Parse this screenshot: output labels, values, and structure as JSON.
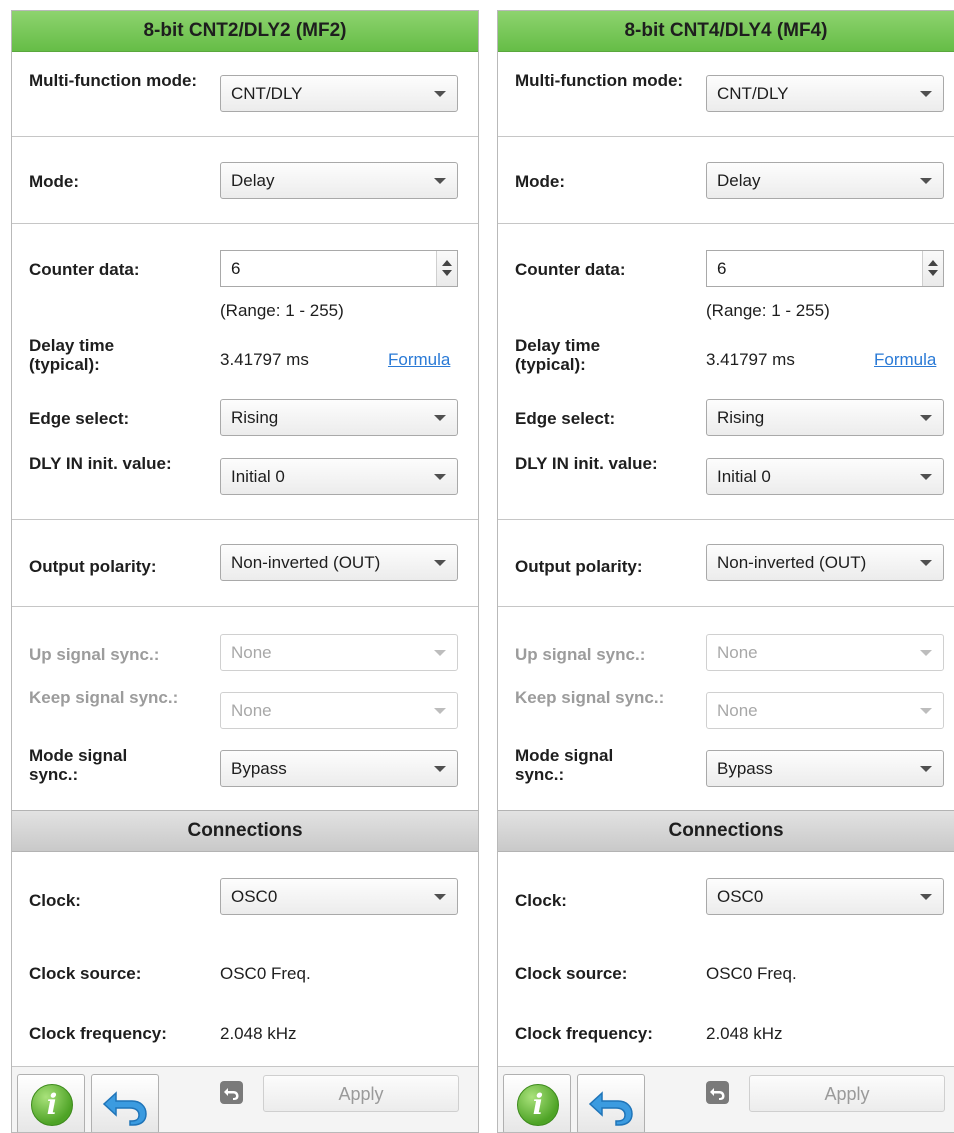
{
  "panels": [
    {
      "title": "8-bit CNT2/DLY2 (MF2)",
      "multi_function_mode_label": "Multi-function mode:",
      "multi_function_mode_value": "CNT/DLY",
      "mode_label": "Mode:",
      "mode_value": "Delay",
      "counter_data_label": "Counter data:",
      "counter_data_value": "6",
      "counter_range": "(Range:  1 - 255)",
      "delay_time_label": "Delay time (typical):",
      "delay_time_value": "3.41797 ms",
      "formula_link": "Formula",
      "edge_select_label": "Edge select:",
      "edge_select_value": "Rising",
      "dly_in_init_label": "DLY IN init. value:",
      "dly_in_init_value": "Initial 0",
      "output_polarity_label": "Output polarity:",
      "output_polarity_value": "Non-inverted (OUT)",
      "up_signal_sync_label": "Up signal sync.:",
      "up_signal_sync_value": "None",
      "keep_signal_sync_label": "Keep signal sync.:",
      "keep_signal_sync_value": "None",
      "mode_signal_sync_label": "Mode signal sync.:",
      "mode_signal_sync_value": "Bypass",
      "connections_title": "Connections",
      "clock_label": "Clock:",
      "clock_value": "OSC0",
      "clock_source_label": "Clock source:",
      "clock_source_value": "OSC0 Freq.",
      "clock_frequency_label": "Clock frequency:",
      "clock_frequency_value": "2.048 kHz",
      "apply_label": "Apply"
    },
    {
      "title": "8-bit CNT4/DLY4 (MF4)",
      "multi_function_mode_label": "Multi-function mode:",
      "multi_function_mode_value": "CNT/DLY",
      "mode_label": "Mode:",
      "mode_value": "Delay",
      "counter_data_label": "Counter data:",
      "counter_data_value": "6",
      "counter_range": "(Range:  1 - 255)",
      "delay_time_label": "Delay time (typical):",
      "delay_time_value": "3.41797 ms",
      "formula_link": "Formula",
      "edge_select_label": "Edge select:",
      "edge_select_value": "Rising",
      "dly_in_init_label": "DLY IN init. value:",
      "dly_in_init_value": "Initial 0",
      "output_polarity_label": "Output polarity:",
      "output_polarity_value": "Non-inverted (OUT)",
      "up_signal_sync_label": "Up signal sync.:",
      "up_signal_sync_value": "None",
      "keep_signal_sync_label": "Keep signal sync.:",
      "keep_signal_sync_value": "None",
      "mode_signal_sync_label": "Mode signal sync.:",
      "mode_signal_sync_value": "Bypass",
      "connections_title": "Connections",
      "clock_label": "Clock:",
      "clock_value": "OSC0",
      "clock_source_label": "Clock source:",
      "clock_source_value": "OSC0 Freq.",
      "clock_frequency_label": "Clock frequency:",
      "clock_frequency_value": "2.048 kHz",
      "apply_label": "Apply"
    }
  ],
  "icons": {
    "info": "info-icon",
    "undo": "undo-icon",
    "apply_undo": "small-undo-icon"
  },
  "colors": {
    "header_green": "#66bd47",
    "link_blue": "#2a7ad6",
    "disabled_text": "#9c9c9c"
  }
}
